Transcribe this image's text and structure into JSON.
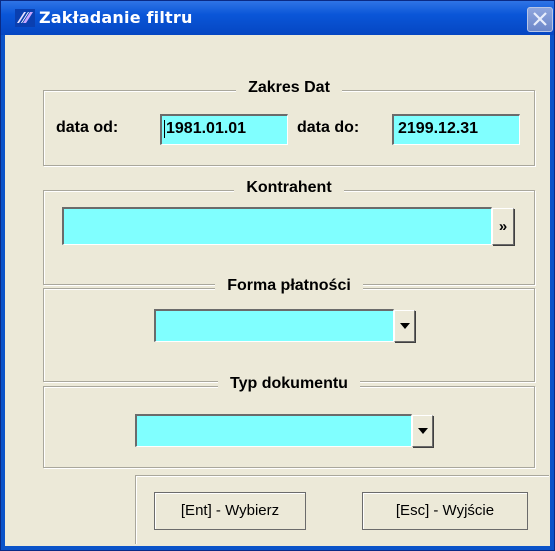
{
  "window": {
    "title": "Zakładanie filtru"
  },
  "date_range": {
    "legend": "Zakres Dat",
    "from_label": "data od:",
    "from_value": "1981.01.01",
    "to_label": "data do:",
    "to_value": "2199.12.31"
  },
  "contractor": {
    "legend": "Kontrahent",
    "value": "",
    "browse_label": "»"
  },
  "payment": {
    "legend": "Forma płatności",
    "selected": ""
  },
  "doc_type": {
    "legend": "Typ dokumentu",
    "selected": ""
  },
  "buttons": {
    "select_label": "[Ent] - Wybierz",
    "exit_label": "[Esc] - Wyjście"
  },
  "colors": {
    "field_bg": "#80ffff",
    "dialog_bg": "#ece9d8",
    "titlebar": "#0a56d8"
  },
  "icons": {
    "app": "app-logo-icon",
    "close": "close-icon",
    "dropdown": "chevron-down-icon"
  }
}
